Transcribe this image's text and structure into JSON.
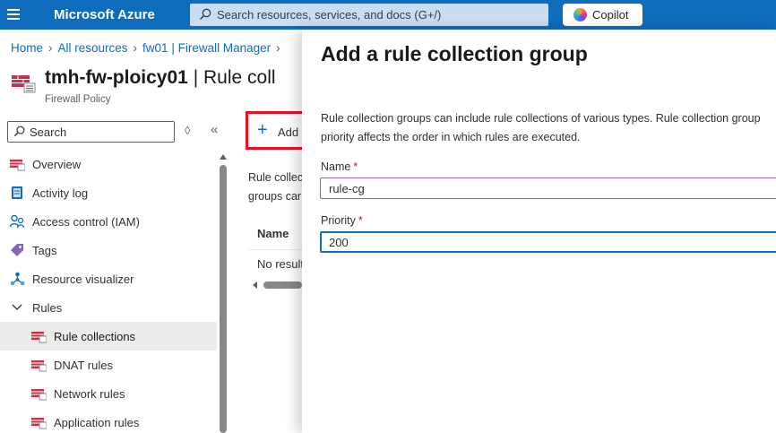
{
  "topbar": {
    "brand": "Microsoft Azure",
    "search_placeholder": "Search resources, services, and docs (G+/)",
    "copilot_label": "Copilot"
  },
  "breadcrumb": [
    "Home",
    "All resources",
    "fw01 | Firewall Manager"
  ],
  "resource": {
    "name": "tmh-fw-ploicy01",
    "page": "| Rule coll",
    "type": "Firewall Policy"
  },
  "nav": {
    "search_placeholder": "Search",
    "items": [
      {
        "label": "Overview",
        "icon": "firewall-policy-icon"
      },
      {
        "label": "Activity log",
        "icon": "activity-log-icon"
      },
      {
        "label": "Access control (IAM)",
        "icon": "access-control-icon"
      },
      {
        "label": "Tags",
        "icon": "tag-icon"
      },
      {
        "label": "Resource visualizer",
        "icon": "resource-visualizer-icon"
      },
      {
        "label": "Rules",
        "icon": "chevron-down-icon"
      },
      {
        "label": "Rule collections",
        "icon": "firewall-rule-icon"
      },
      {
        "label": "DNAT rules",
        "icon": "firewall-rule-icon"
      },
      {
        "label": "Network rules",
        "icon": "firewall-rule-icon"
      },
      {
        "label": "Application rules",
        "icon": "firewall-rule-icon"
      }
    ]
  },
  "main": {
    "add_label": "Add",
    "description_line1": "Rule collec",
    "description_line2": "groups car",
    "column_name": "Name",
    "no_results": "No result"
  },
  "blade": {
    "title": "Add a rule collection group",
    "description": "Rule collection groups can include rule collections of various types. Rule collection group priority affects the order in which rules are executed.",
    "name_label": "Name",
    "name_value": "rule-cg",
    "priority_label": "Priority",
    "priority_value": "200",
    "required_marker": "*"
  },
  "colors": {
    "topbar": "#0f6cbd",
    "accent": "#0f6cbd",
    "highlight_box": "#e81123",
    "required": "#a4262c",
    "selected_nav": "#edebe9"
  }
}
